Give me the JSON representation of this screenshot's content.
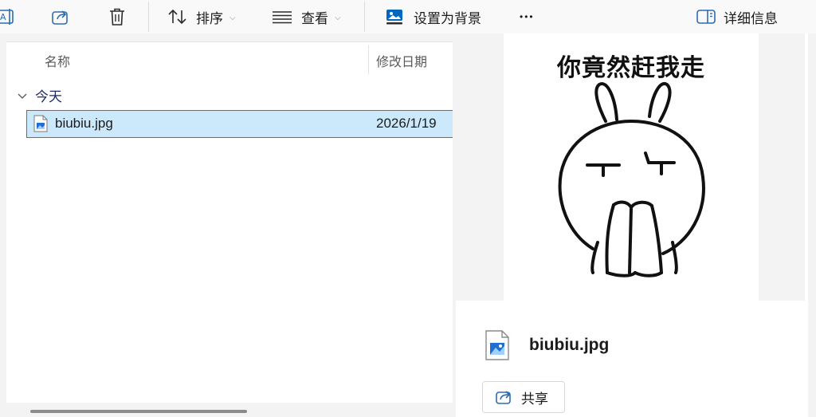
{
  "toolbar": {
    "sort_label": "排序",
    "view_label": "查看",
    "set_bg_label": "设置为背景",
    "more_label": "•••",
    "details_label": "详细信息"
  },
  "columns": {
    "name": "名称",
    "date": "修改日期"
  },
  "group": {
    "label": "今天"
  },
  "files": [
    {
      "name": "biubiu.jpg",
      "date": "2026/1/19"
    }
  ],
  "preview": {
    "image_caption": "你竟然赶我走",
    "file_name": "biubiu.jpg",
    "share_label": "共享"
  },
  "colors": {
    "accent": "#0067c0",
    "selection_bg": "#cce8fb",
    "group_text": "#1c2a6b"
  }
}
